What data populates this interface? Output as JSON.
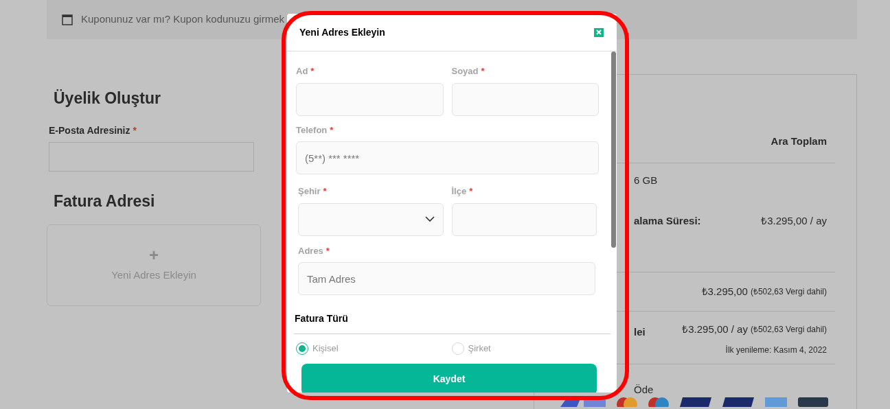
{
  "page": {
    "coupon_notice": "Kuponunuz var mı? Kupon kodunuzu girmek",
    "account_heading": "Üyelik Oluştur",
    "email_field": {
      "label": "E-Posta Adresiniz",
      "required_mark": "*"
    },
    "billing_heading": "Fatura Adresi",
    "add_address_card": {
      "icon": "+",
      "label": "Yeni Adres Ekleyin"
    }
  },
  "order_summary": {
    "column_header": "Ara Toplam",
    "product": "6 GB",
    "rows": [
      {
        "label": "alama Süresi:",
        "value": "₺3.295,00 / ay"
      },
      {
        "value": "₺3.295,00",
        "note": "(₺502,63 Vergi dahil)"
      },
      {
        "label": "lei",
        "value": "₺3.295,00 / ay",
        "note": "(₺502,63 Vergi dahil)",
        "sub": "İlk yenileme: Kasım 4, 2022"
      }
    ],
    "payment_label": "Öde"
  },
  "modal": {
    "title": "Yeni Adres Ekleyin",
    "fields": [
      {
        "label": "Ad",
        "required_mark": "*",
        "kind": "text"
      },
      {
        "label": "Soyad",
        "required_mark": "*",
        "kind": "text"
      },
      {
        "label": "Telefon",
        "required_mark": "*",
        "kind": "text",
        "placeholder": "(5**) *** ****"
      },
      {
        "label": "Şehir",
        "required_mark": "*",
        "kind": "select"
      },
      {
        "label": "İlçe",
        "required_mark": "*",
        "kind": "text"
      },
      {
        "label": "Adres",
        "required_mark": "*",
        "kind": "text",
        "placeholder": "Tam Adres"
      }
    ],
    "invoice_type": {
      "heading": "Fatura Türü",
      "options": [
        {
          "label": "Kişisel",
          "selected": true
        },
        {
          "label": "Şirket",
          "selected": false
        }
      ]
    },
    "save_button": "Kaydet"
  }
}
